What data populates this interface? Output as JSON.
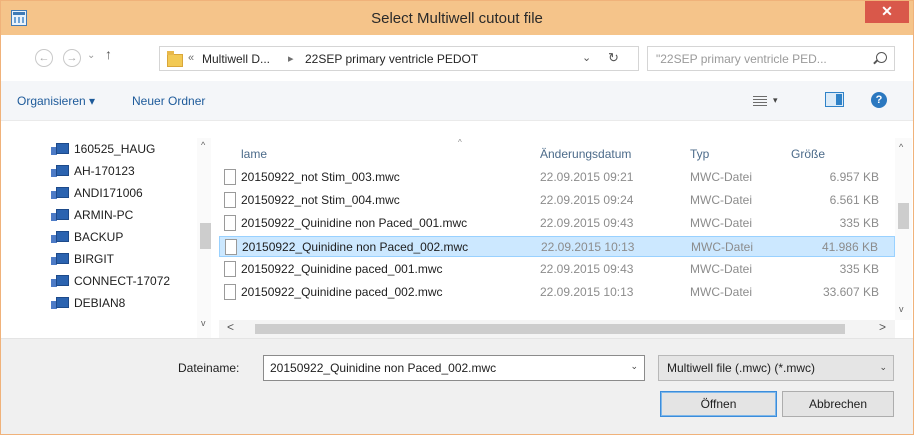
{
  "window": {
    "title": "Select Multiwell cutout file",
    "close_glyph": "✕"
  },
  "navbar": {
    "back_glyph": "←",
    "forward_glyph": "→",
    "recent_glyph": "⌄",
    "up_glyph": "↑",
    "overflow_glyph": "«",
    "breadcrumb": [
      "Multiwell D...",
      "22SEP primary ventricle PEDOT"
    ],
    "breadcrumb_sep": "▸",
    "dropdown_glyph": "⌄",
    "refresh_glyph": "↻",
    "search_placeholder": "\"22SEP primary ventricle PED..."
  },
  "toolbar": {
    "organize_label": "Organisieren ▾",
    "new_folder_label": "Neuer Ordner",
    "view_dropdown_glyph": "▾",
    "help_glyph": "?"
  },
  "tree": {
    "items": [
      "160525_HAUG",
      "AH-170123",
      "ANDI171006",
      "ARMIN-PC",
      "BACKUP",
      "BIRGIT",
      "CONNECT-17072",
      "DEBIAN8"
    ],
    "scroll_up": "^",
    "scroll_down": "v"
  },
  "list": {
    "headers": {
      "name": "lame",
      "date": "Änderungsdatum",
      "type": "Typ",
      "size": "Größe"
    },
    "sort_glyph": "^",
    "selected_index": 3,
    "rows": [
      {
        "name": "20150922_not Stim_003.mwc",
        "date": "22.09.2015 09:21",
        "type": "MWC-Datei",
        "size": "6.957 KB"
      },
      {
        "name": "20150922_not Stim_004.mwc",
        "date": "22.09.2015 09:24",
        "type": "MWC-Datei",
        "size": "6.561 KB"
      },
      {
        "name": "20150922_Quinidine non Paced_001.mwc",
        "date": "22.09.2015 09:43",
        "type": "MWC-Datei",
        "size": "335 KB"
      },
      {
        "name": "20150922_Quinidine non Paced_002.mwc",
        "date": "22.09.2015 10:13",
        "type": "MWC-Datei",
        "size": "41.986 KB"
      },
      {
        "name": "20150922_Quinidine paced_001.mwc",
        "date": "22.09.2015 09:43",
        "type": "MWC-Datei",
        "size": "335 KB"
      },
      {
        "name": "20150922_Quinidine paced_002.mwc",
        "date": "22.09.2015 10:13",
        "type": "MWC-Datei",
        "size": "33.607 KB"
      }
    ],
    "scroll_up": "^",
    "scroll_down": "v",
    "scroll_left": "<",
    "scroll_right": ">"
  },
  "footer": {
    "filename_label": "Dateiname:",
    "filename_value": "20150922_Quinidine non Paced_002.mwc",
    "filename_dropdown_glyph": "⌄",
    "filter_value": "Multiwell file (.mwc) (*.mwc)",
    "filter_dropdown_glyph": "⌄",
    "open_label": "Öffnen",
    "cancel_label": "Abbrechen"
  }
}
